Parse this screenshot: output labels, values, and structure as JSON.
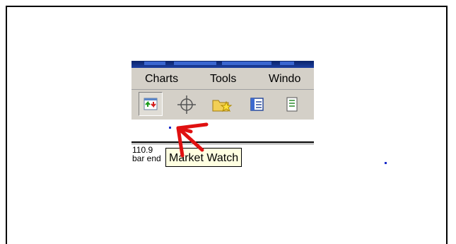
{
  "menu": {
    "items": [
      {
        "label": "Charts"
      },
      {
        "label": "Tools"
      },
      {
        "label": "Windo"
      }
    ]
  },
  "toolbar": {
    "buttons": [
      {
        "icon": "market-watch-icon",
        "pressed": true
      },
      {
        "icon": "crosshair-icon"
      },
      {
        "icon": "folder-star-icon"
      },
      {
        "icon": "navigator-icon"
      },
      {
        "icon": "terminal-icon"
      }
    ]
  },
  "chart": {
    "value_text": "110.9",
    "bar_end_text": "bar end"
  },
  "tooltip": {
    "text": "Market Watch"
  },
  "colors": {
    "title_bar": "#0a246a",
    "menu_bg": "#d4d0c8",
    "tooltip_bg": "#ffffe1",
    "arrow": "#e01010",
    "dot": "#1b2cc9"
  }
}
